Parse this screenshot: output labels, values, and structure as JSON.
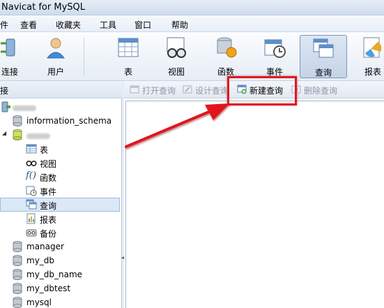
{
  "window": {
    "title": "Navicat for MySQL"
  },
  "menu": {
    "items": [
      "件",
      "查看",
      "收藏夹",
      "工具",
      "窗口",
      "帮助"
    ]
  },
  "toolbar": {
    "items": [
      {
        "label": "连接",
        "icon": "connection-icon"
      },
      {
        "label": "用户",
        "icon": "user-icon"
      },
      {
        "label": "表",
        "icon": "table-icon"
      },
      {
        "label": "视图",
        "icon": "view-icon"
      },
      {
        "label": "函数",
        "icon": "function-icon"
      },
      {
        "label": "事件",
        "icon": "event-icon"
      },
      {
        "label": "查询",
        "icon": "query-icon",
        "active": true
      },
      {
        "label": "报表",
        "icon": "report-icon"
      }
    ]
  },
  "left_panel": {
    "header": "接",
    "tree": [
      {
        "label": "information_schema",
        "icon": "database-icon"
      },
      {
        "label": "表",
        "icon": "table-icon"
      },
      {
        "label": "视图",
        "icon": "view-icon"
      },
      {
        "label": "函数",
        "icon": "function-icon"
      },
      {
        "label": "事件",
        "icon": "event-icon"
      },
      {
        "label": "查询",
        "icon": "query-icon",
        "selected": true
      },
      {
        "label": "报表",
        "icon": "report-icon"
      },
      {
        "label": "备份",
        "icon": "backup-icon"
      },
      {
        "label": "manager",
        "icon": "database-icon"
      },
      {
        "label": "my_db",
        "icon": "database-icon"
      },
      {
        "label": "my_db_name",
        "icon": "database-icon"
      },
      {
        "label": "my_dbtest",
        "icon": "database-icon"
      },
      {
        "label": "mysql",
        "icon": "database-icon"
      }
    ]
  },
  "sub_toolbar": {
    "open_query": "打开查询",
    "design_query": "设计查询",
    "new_query": "新建查询",
    "delete_query": "删除查询"
  },
  "colors": {
    "annotation": "#e0191d",
    "accent": "#3c78c8"
  }
}
